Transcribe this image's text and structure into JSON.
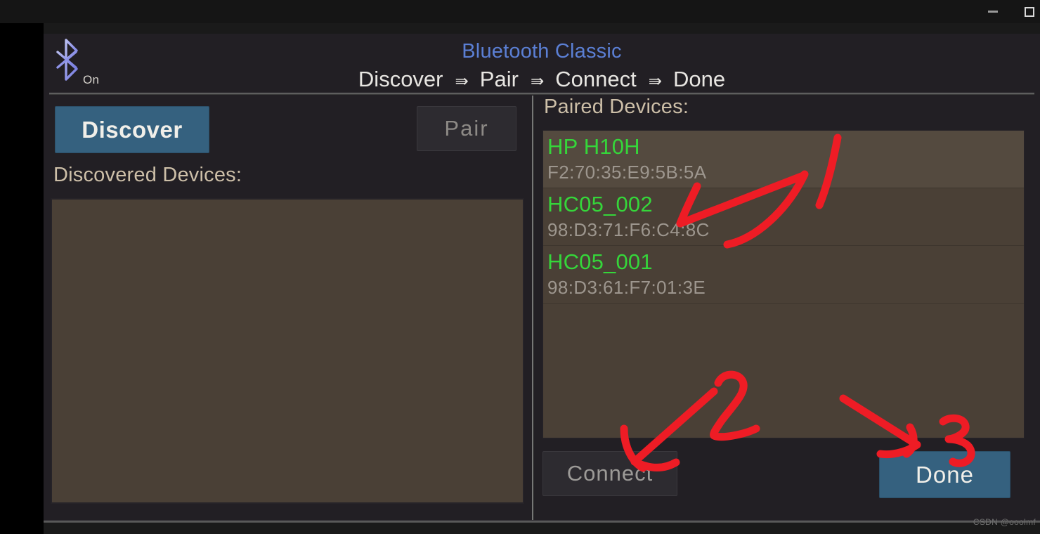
{
  "window": {
    "minimize_label": "—",
    "maximize_label": "□"
  },
  "header": {
    "bluetooth_icon": "bluetooth-icon",
    "bluetooth_state": "On",
    "title": "Bluetooth Classic",
    "steps": [
      {
        "label": "Discover"
      },
      {
        "label": "Pair"
      },
      {
        "label": "Connect"
      },
      {
        "label": "Done"
      }
    ],
    "step_arrow": "⇛"
  },
  "left_panel": {
    "discover_button": "Discover",
    "pair_button": "Pair",
    "discovered_label": "Discovered Devices:",
    "discovered_devices": []
  },
  "right_panel": {
    "paired_label": "Paired Devices:",
    "paired_devices": [
      {
        "name": "HP H10H",
        "mac": "F2:70:35:E9:5B:5A",
        "selected": true
      },
      {
        "name": "HC05_002",
        "mac": "98:D3:71:F6:C4:8C",
        "selected": false
      },
      {
        "name": "HC05_001",
        "mac": "98:D3:61:F7:01:3E",
        "selected": false
      }
    ],
    "connect_button": "Connect",
    "done_button": "Done"
  },
  "annotations": [
    {
      "id": "annotation-1",
      "label": "1",
      "points_to": "HC05_002"
    },
    {
      "id": "annotation-2",
      "label": "2",
      "points_to": "Connect"
    },
    {
      "id": "annotation-3",
      "label": "3",
      "points_to": "Done"
    }
  ],
  "annotation_color": "#ee1c25",
  "colors": {
    "accent_blue": "#35617f",
    "title_blue": "#5b7fd4",
    "device_green": "#35d63a",
    "label_tan": "#cdbfa8",
    "list_brown": "#4a4036"
  },
  "watermark": "CSDN @ooolmf"
}
